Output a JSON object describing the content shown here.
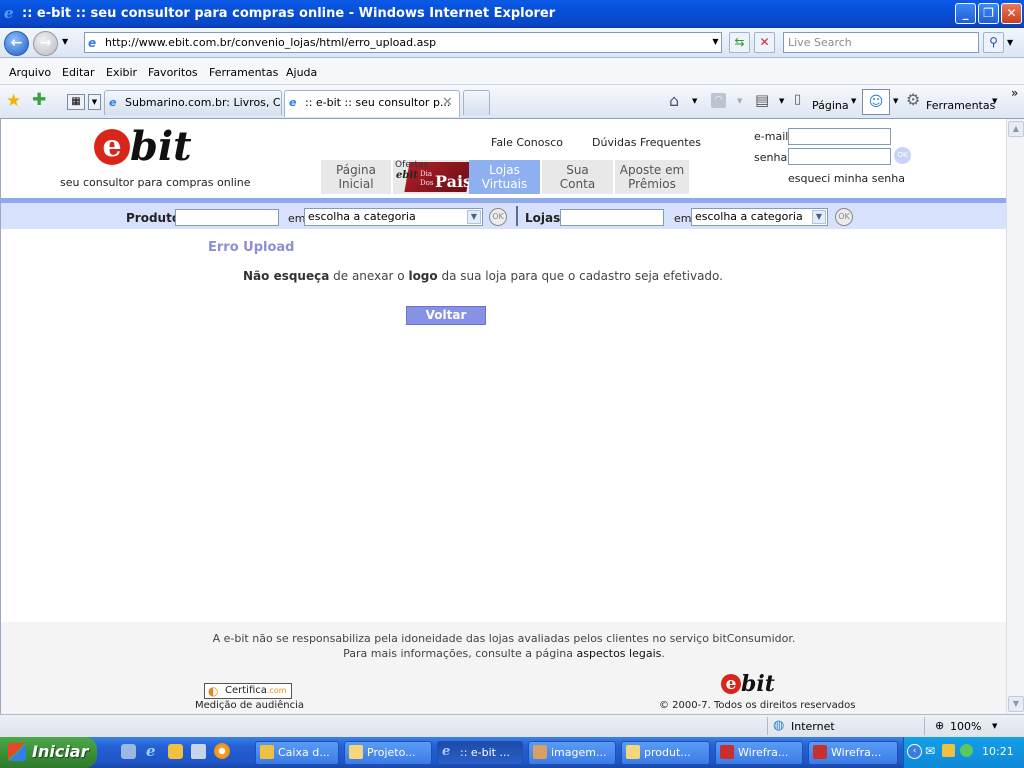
{
  "window": {
    "title": ":: e-bit :: seu consultor para compras online - Windows Internet Explorer"
  },
  "address": {
    "url": "http://www.ebit.com.br/convenio_lojas/html/erro_upload.asp",
    "search_placeholder": "Live Search"
  },
  "menu": [
    "Arquivo",
    "Editar",
    "Exibir",
    "Favoritos",
    "Ferramentas",
    "Ajuda"
  ],
  "tabs": [
    {
      "label": "Submarino.com.br: Livros, C..."
    },
    {
      "label": ":: e-bit :: seu consultor p..."
    }
  ],
  "toolbar": {
    "page_label": "Página",
    "tools_label": "Ferramentas"
  },
  "site": {
    "logo_letter": "e",
    "logo_text": "bit",
    "tagline": "seu consultor para compras online",
    "top_links": [
      "Fale Conosco",
      "Dúvidas Frequentes"
    ],
    "login": {
      "email_label": "e-mail",
      "password_label": "senha",
      "ok_label": "OK",
      "forgot_label": "esqueci minha senha"
    },
    "nav": [
      {
        "line1": "Página",
        "line2": "Inicial"
      },
      {
        "line1": "Lojas",
        "line2": "Virtuais"
      },
      {
        "line1": "Sua",
        "line2": "Conta"
      },
      {
        "line1": "Aposte em",
        "line2": "Prêmios"
      }
    ],
    "promo": {
      "ofertas": "Ofertas",
      "brand": "ebit",
      "dia": "Dia",
      "dos": "Dos",
      "pais": "Pais"
    },
    "search": {
      "produto_label": "Produto",
      "lojas_label": "Lojas",
      "em_label": "em",
      "category_value": "escolha a categoria",
      "ok_label": "OK"
    }
  },
  "error": {
    "title": "Erro Upload",
    "msg_part1": "Não esqueça",
    "msg_part2": " de anexar o ",
    "msg_part3": "logo",
    "msg_part4": " da sua loja para que o cadastro seja efetivado.",
    "button": "Voltar"
  },
  "footer": {
    "disclaimer1": "A e-bit não se responsabiliza pela idoneidade das lojas avaliadas pelos clientes no serviço bitConsumidor.",
    "disclaimer2_prefix": "Para mais informações, consulte a página ",
    "disclaimer2_link": "aspectos legais",
    "disclaimer2_suffix": ".",
    "certifica_label": "Certifica",
    "certifica_suffix": ".com",
    "audience_label": "Medição de audiência",
    "copyright": "© 2000-7. Todos os direitos reservados"
  },
  "status": {
    "zone": "Internet",
    "zoom": "100%"
  },
  "taskbar": {
    "start": "Iniciar",
    "tasks": [
      "Caixa d...",
      "Projeto...",
      ":: e-bit ...",
      "imagem...",
      "produt...",
      "Wirefra...",
      "Wirefra..."
    ],
    "clock": "10:21"
  }
}
